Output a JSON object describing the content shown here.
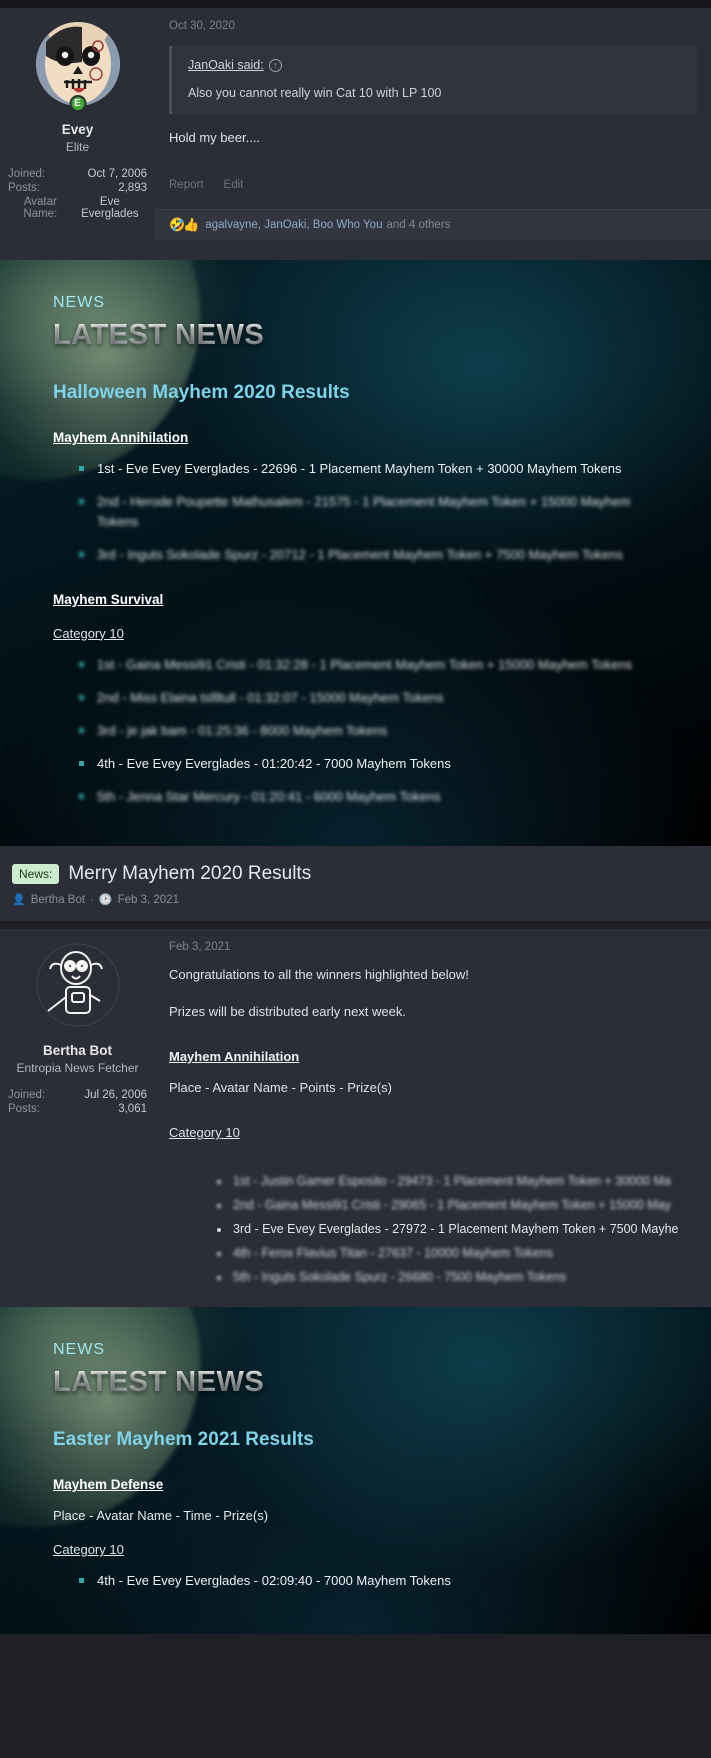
{
  "post1": {
    "author": "Evey",
    "title": "Elite",
    "stats": [
      {
        "label": "Joined:",
        "value": "Oct 7, 2006"
      },
      {
        "label": "Posts:",
        "value": "2,893"
      },
      {
        "label": "Avatar Name:",
        "value": "Eve Everglades"
      }
    ],
    "date": "Oct 30, 2020",
    "quote_author": "JanOaki said:",
    "quote_text": "Also you cannot really win Cat 10 with LP 100",
    "body": "Hold my beer....",
    "actions": {
      "report": "Report",
      "edit": "Edit"
    },
    "reactions": {
      "emoji": "🤣👍",
      "names": "agalvayne, JanOaki, Boo Who You",
      "others": "and 4 others"
    }
  },
  "news1": {
    "kicker": "NEWS",
    "title": "LATEST NEWS",
    "subtitle": "Halloween Mayhem 2020 Results",
    "section1_heading": "Mayhem Annihilation",
    "section1_items": [
      "1st - Eve Evey Everglades - 22696 - 1 Placement Mayhem Token + 30000 Mayhem Tokens",
      "2nd - Herode Poupette Mathusalem - 21575 - 1 Placement Mayhem Token + 15000 Mayhem Tokens",
      "3rd - Inguts Sokolade Spurz - 20712 - 1 Placement Mayhem Token + 7500 Mayhem Tokens"
    ],
    "section2_heading": "Mayhem Survival",
    "section2_category": "Category 10",
    "section2_items": [
      "1st - Gaina Messi91 Cristi - 01:32:28 - 1 Placement Mayhem Token + 15000 Mayhem Tokens",
      "2nd - Miss Elaina tsllltull - 01:32:07 - 15000 Mayhem Tokens",
      "3rd - je jak bam - 01:25:36 - 8000 Mayhem Tokens",
      "4th - Eve Evey Everglades - 01:20:42 - 7000 Mayhem Tokens",
      "5th - Jenna Star Mercury - 01:20:41 - 6000 Mayhem Tokens"
    ]
  },
  "thread": {
    "badge": "News:",
    "title": "Merry Mayhem 2020 Results",
    "author": "Bertha Bot",
    "date": "Feb 3, 2021"
  },
  "post2": {
    "author": "Bertha Bot",
    "title": "Entropia News Fetcher",
    "stats": [
      {
        "label": "Joined:",
        "value": "Jul 26, 2006"
      },
      {
        "label": "Posts:",
        "value": "3,061"
      }
    ],
    "date": "Feb 3, 2021",
    "line1": "Congratulations to all the winners highlighted below!",
    "line2": "Prizes will be distributed early next week.",
    "heading": "Mayhem Annihilation",
    "subheading": "Place - Avatar Name - Points - Prize(s)",
    "category": "Category 10",
    "items": [
      "1st - Justin Gamer Esposito - 29473 - 1 Placement Mayhem Token + 30000 Ma",
      "2nd - Gaina Messi91 Cristi - 29065 - 1 Placement Mayhem Token + 15000 May",
      "3rd - Eve Evey Everglades - 27972 - 1 Placement Mayhem Token + 7500 Mayhe",
      "4th - Ferox Flavius Titan - 27637 - 10000 Mayhem Tokens",
      "5th - Inguts Sokolade Spurz - 26680 - 7500 Mayhem Tokens"
    ]
  },
  "news2": {
    "kicker": "NEWS",
    "title": "LATEST NEWS",
    "subtitle": "Easter Mayhem 2021 Results",
    "heading": "Mayhem Defense",
    "subheading": "Place - Avatar Name - Time - Prize(s)",
    "category": "Category 10",
    "items": [
      "4th - Eve Evey Everglades - 02:09:40 - 7000 Mayhem Tokens"
    ]
  }
}
